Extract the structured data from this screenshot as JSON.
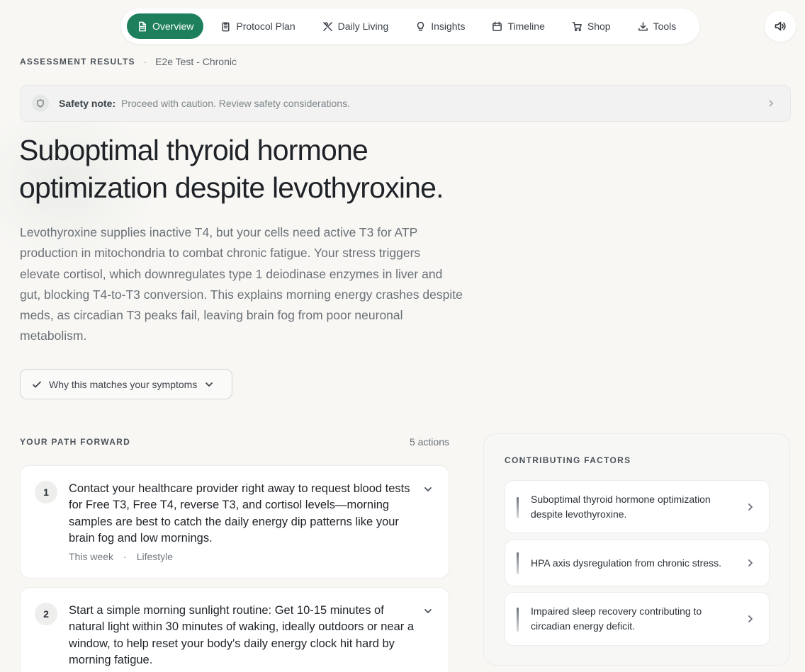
{
  "nav": {
    "tabs": [
      {
        "label": "Overview",
        "icon": "document-icon",
        "active": true
      },
      {
        "label": "Protocol Plan",
        "icon": "clipboard-icon"
      },
      {
        "label": "Daily Living",
        "icon": "utensils-icon"
      },
      {
        "label": "Insights",
        "icon": "lightbulb-icon"
      },
      {
        "label": "Timeline",
        "icon": "calendar-icon"
      },
      {
        "label": "Shop",
        "icon": "cart-icon"
      },
      {
        "label": "Tools",
        "icon": "download-icon"
      }
    ],
    "accent_color": "#1d7f5c",
    "sound_icon": "speaker-icon"
  },
  "breadcrumb": {
    "section": "ASSESSMENT RESULTS",
    "separator": "·",
    "assessment": "E2e Test - Chronic"
  },
  "safety": {
    "label": "Safety note:",
    "text": "Proceed with caution. Review safety considerations."
  },
  "headline": "Suboptimal thyroid hormone optimization despite levothyroxine.",
  "summary": "Levothyroxine supplies inactive T4, but your cells need active T3 for ATP production in mitochondria to combat chronic fatigue. Your stress triggers elevate cortisol, which downregulates type 1 deiodinase enzymes in liver and gut, blocking T4-to-T3 conversion. This explains morning energy crashes despite meds, as circadian T3 peaks fail, leaving brain fog from poor neuronal metabolism.",
  "why_button": "Why this matches your symptoms",
  "path": {
    "title": "YOUR PATH FORWARD",
    "count": "5 actions",
    "actions": [
      {
        "number": "1",
        "text": "Contact your healthcare provider right away to request blood tests for Free T3, Free T4, reverse T3, and cortisol levels—morning samples are best to catch the daily energy dip patterns like your brain fog and low mornings.",
        "timing": "This week",
        "separator": "·",
        "category": "Lifestyle"
      },
      {
        "number": "2",
        "text": "Start a simple morning sunlight routine: Get 10-15 minutes of natural light within 30 minutes of waking, ideally outdoors or near a window, to help reset your body's daily energy clock hit hard by morning fatigue."
      }
    ]
  },
  "factors": {
    "title": "CONTRIBUTING FACTORS",
    "items": [
      "Suboptimal thyroid hormone optimization despite levothyroxine.",
      "HPA axis dysregulation from chronic stress.",
      "Impaired sleep recovery contributing to circadian energy deficit."
    ]
  }
}
